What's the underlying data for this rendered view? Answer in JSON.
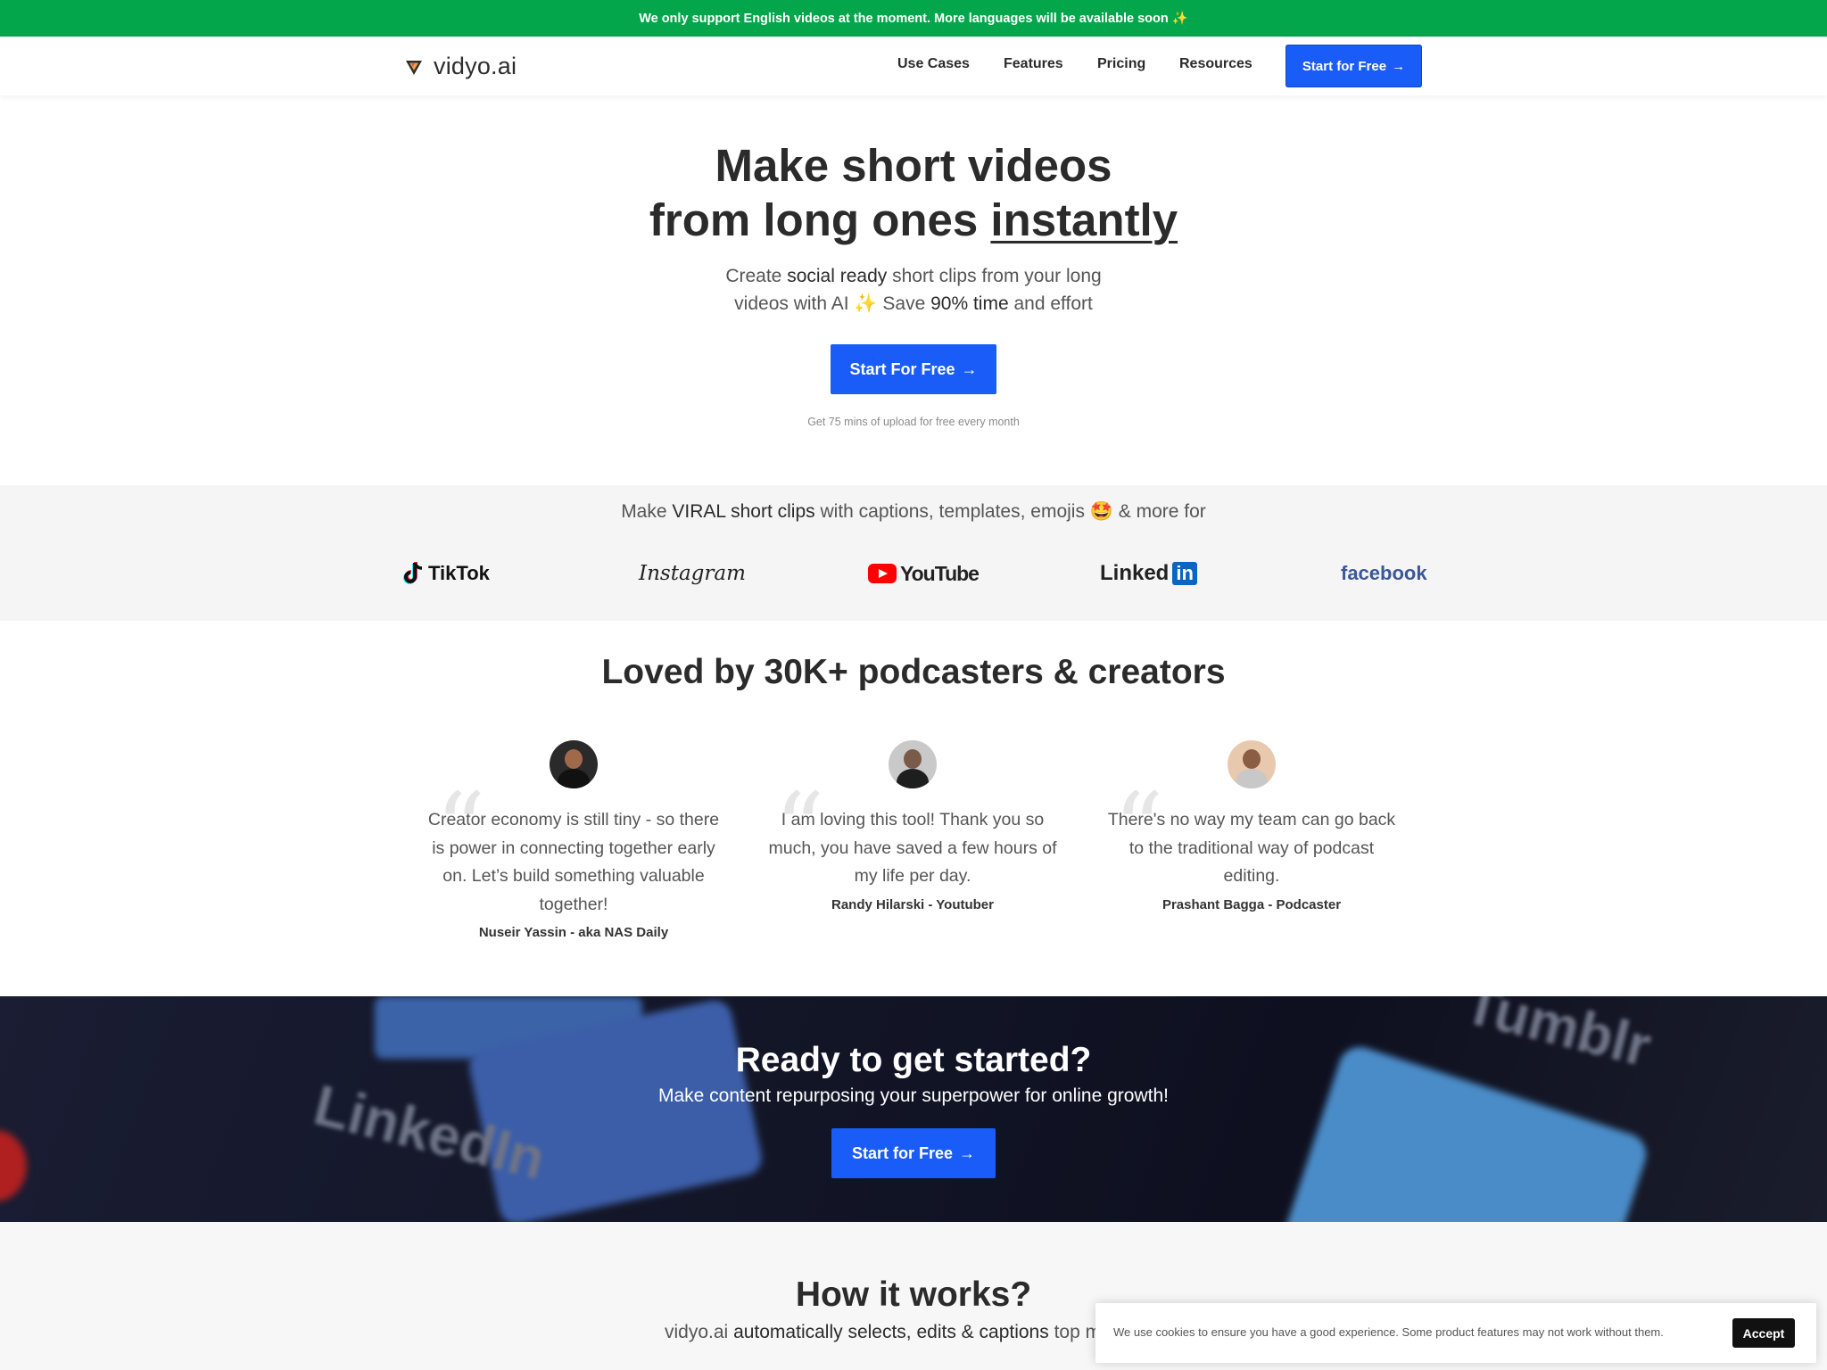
{
  "banner": {
    "text": "We only support English videos at the moment. More languages will be available soon ✨"
  },
  "nav": {
    "brand": "vidyo.ai",
    "links": [
      "Use Cases",
      "Features",
      "Pricing",
      "Resources"
    ],
    "cta": "Start for Free"
  },
  "hero": {
    "title_line1": "Make short videos",
    "title_line2_prefix": "from long ones ",
    "title_line2_emph": "instantly",
    "sub_p1": "Create ",
    "sub_b1": "social ready",
    "sub_p2": " short clips from your long",
    "sub_p3": "videos with AI ✨ Save ",
    "sub_b2": "90% time",
    "sub_p4": " and effort",
    "cta": "Start For Free",
    "note": "Get 75 mins of upload for free every month"
  },
  "platforms": {
    "title_p1": "Make ",
    "title_b1": "VIRAL short clips",
    "title_p2": " with captions, templates, emojis 🤩 & more for",
    "tiktok": "TikTok",
    "instagram": "Instagram",
    "youtube": "YouTube",
    "linkedin_a": "Linked",
    "linkedin_b": "in",
    "facebook": "facebook"
  },
  "testimonials": {
    "title": "Loved by 30K+ podcasters & creators",
    "items": [
      {
        "quote": "Creator economy is still tiny - so there is power in connecting together early on. Let’s build something valuable together!",
        "author": "Nuseir Yassin - aka NAS Daily"
      },
      {
        "quote": "I am loving this tool! Thank you so much, you have saved a few hours of my life per day.",
        "author": "Randy Hilarski - Youtuber"
      },
      {
        "quote": "There's no way my team can go back to the traditional way of podcast editing.",
        "author": "Prashant Bagga - Podcaster"
      }
    ]
  },
  "ready": {
    "title": "Ready to get started?",
    "sub": "Make content repurposing your superpower for online growth!",
    "cta": "Start for Free",
    "bg_words": [
      "LinkedIn",
      "Tumblr"
    ]
  },
  "how": {
    "title": "How it works?",
    "sub_p1": "vidyo.ai ",
    "sub_b1": "automatically selects, edits & captions",
    "sub_p2": " top moments"
  },
  "cookie": {
    "text": "We use cookies to ensure you have a good experience. Some product features may not work without them.",
    "button": "Accept"
  },
  "colors": {
    "brand_blue": "#1a5cf7",
    "banner_green": "#03a64a"
  }
}
